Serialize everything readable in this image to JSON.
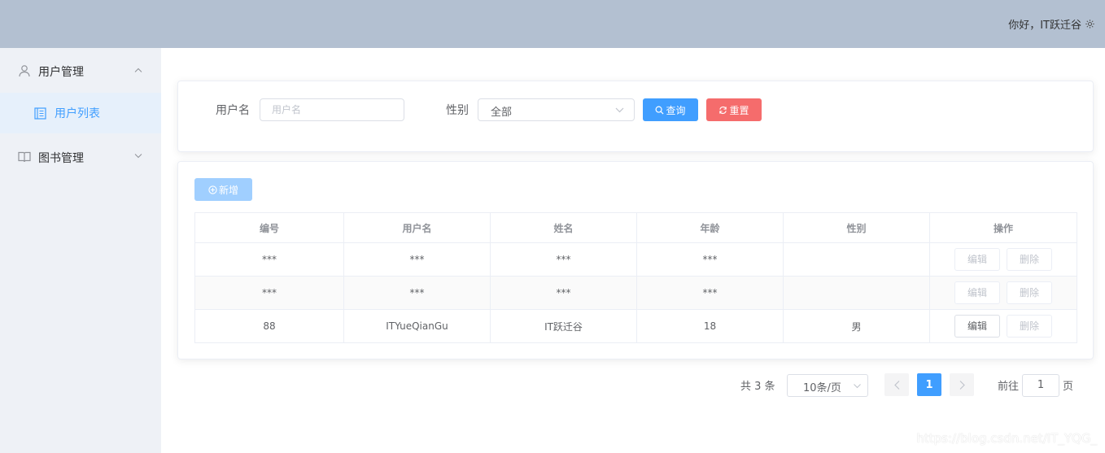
{
  "header": {
    "greeting": "你好，IT跃迁谷",
    "settings_icon": "gear-icon"
  },
  "sidebar": {
    "items": [
      {
        "label": "用户管理",
        "icon": "user-icon",
        "expanded": true,
        "children": [
          {
            "label": "用户列表",
            "icon": "list-icon",
            "active": true
          }
        ]
      },
      {
        "label": "图书管理",
        "icon": "book-icon",
        "expanded": false
      }
    ]
  },
  "search": {
    "username_label": "用户名",
    "username_placeholder": "用户名",
    "username_value": "",
    "gender_label": "性别",
    "gender_value": "全部",
    "query_button": "查询",
    "reset_button": "重置"
  },
  "table": {
    "add_button": "新增",
    "columns": [
      "编号",
      "用户名",
      "姓名",
      "年龄",
      "性别",
      "操作"
    ],
    "rows": [
      {
        "id": "***",
        "username": "***",
        "name": "***",
        "age": "***",
        "gender": ""
      },
      {
        "id": "***",
        "username": "***",
        "name": "***",
        "age": "***",
        "gender": ""
      },
      {
        "id": "88",
        "username": "ITYueQianGu",
        "name": "IT跃迁谷",
        "age": "18",
        "gender": "男"
      }
    ],
    "edit_label": "编辑",
    "delete_label": "删除"
  },
  "pagination": {
    "total": "共 3 条",
    "page_size": "10条/页",
    "current_page": "1",
    "goto_label": "前往",
    "goto_value": "1",
    "page_unit": "页"
  },
  "watermark": "https://blog.csdn.net/IT_YQG_",
  "colors": {
    "header_bg": "#b3c0d1",
    "sidebar_bg": "#eef1f6",
    "primary": "#409eff",
    "danger": "#f56c6c"
  }
}
